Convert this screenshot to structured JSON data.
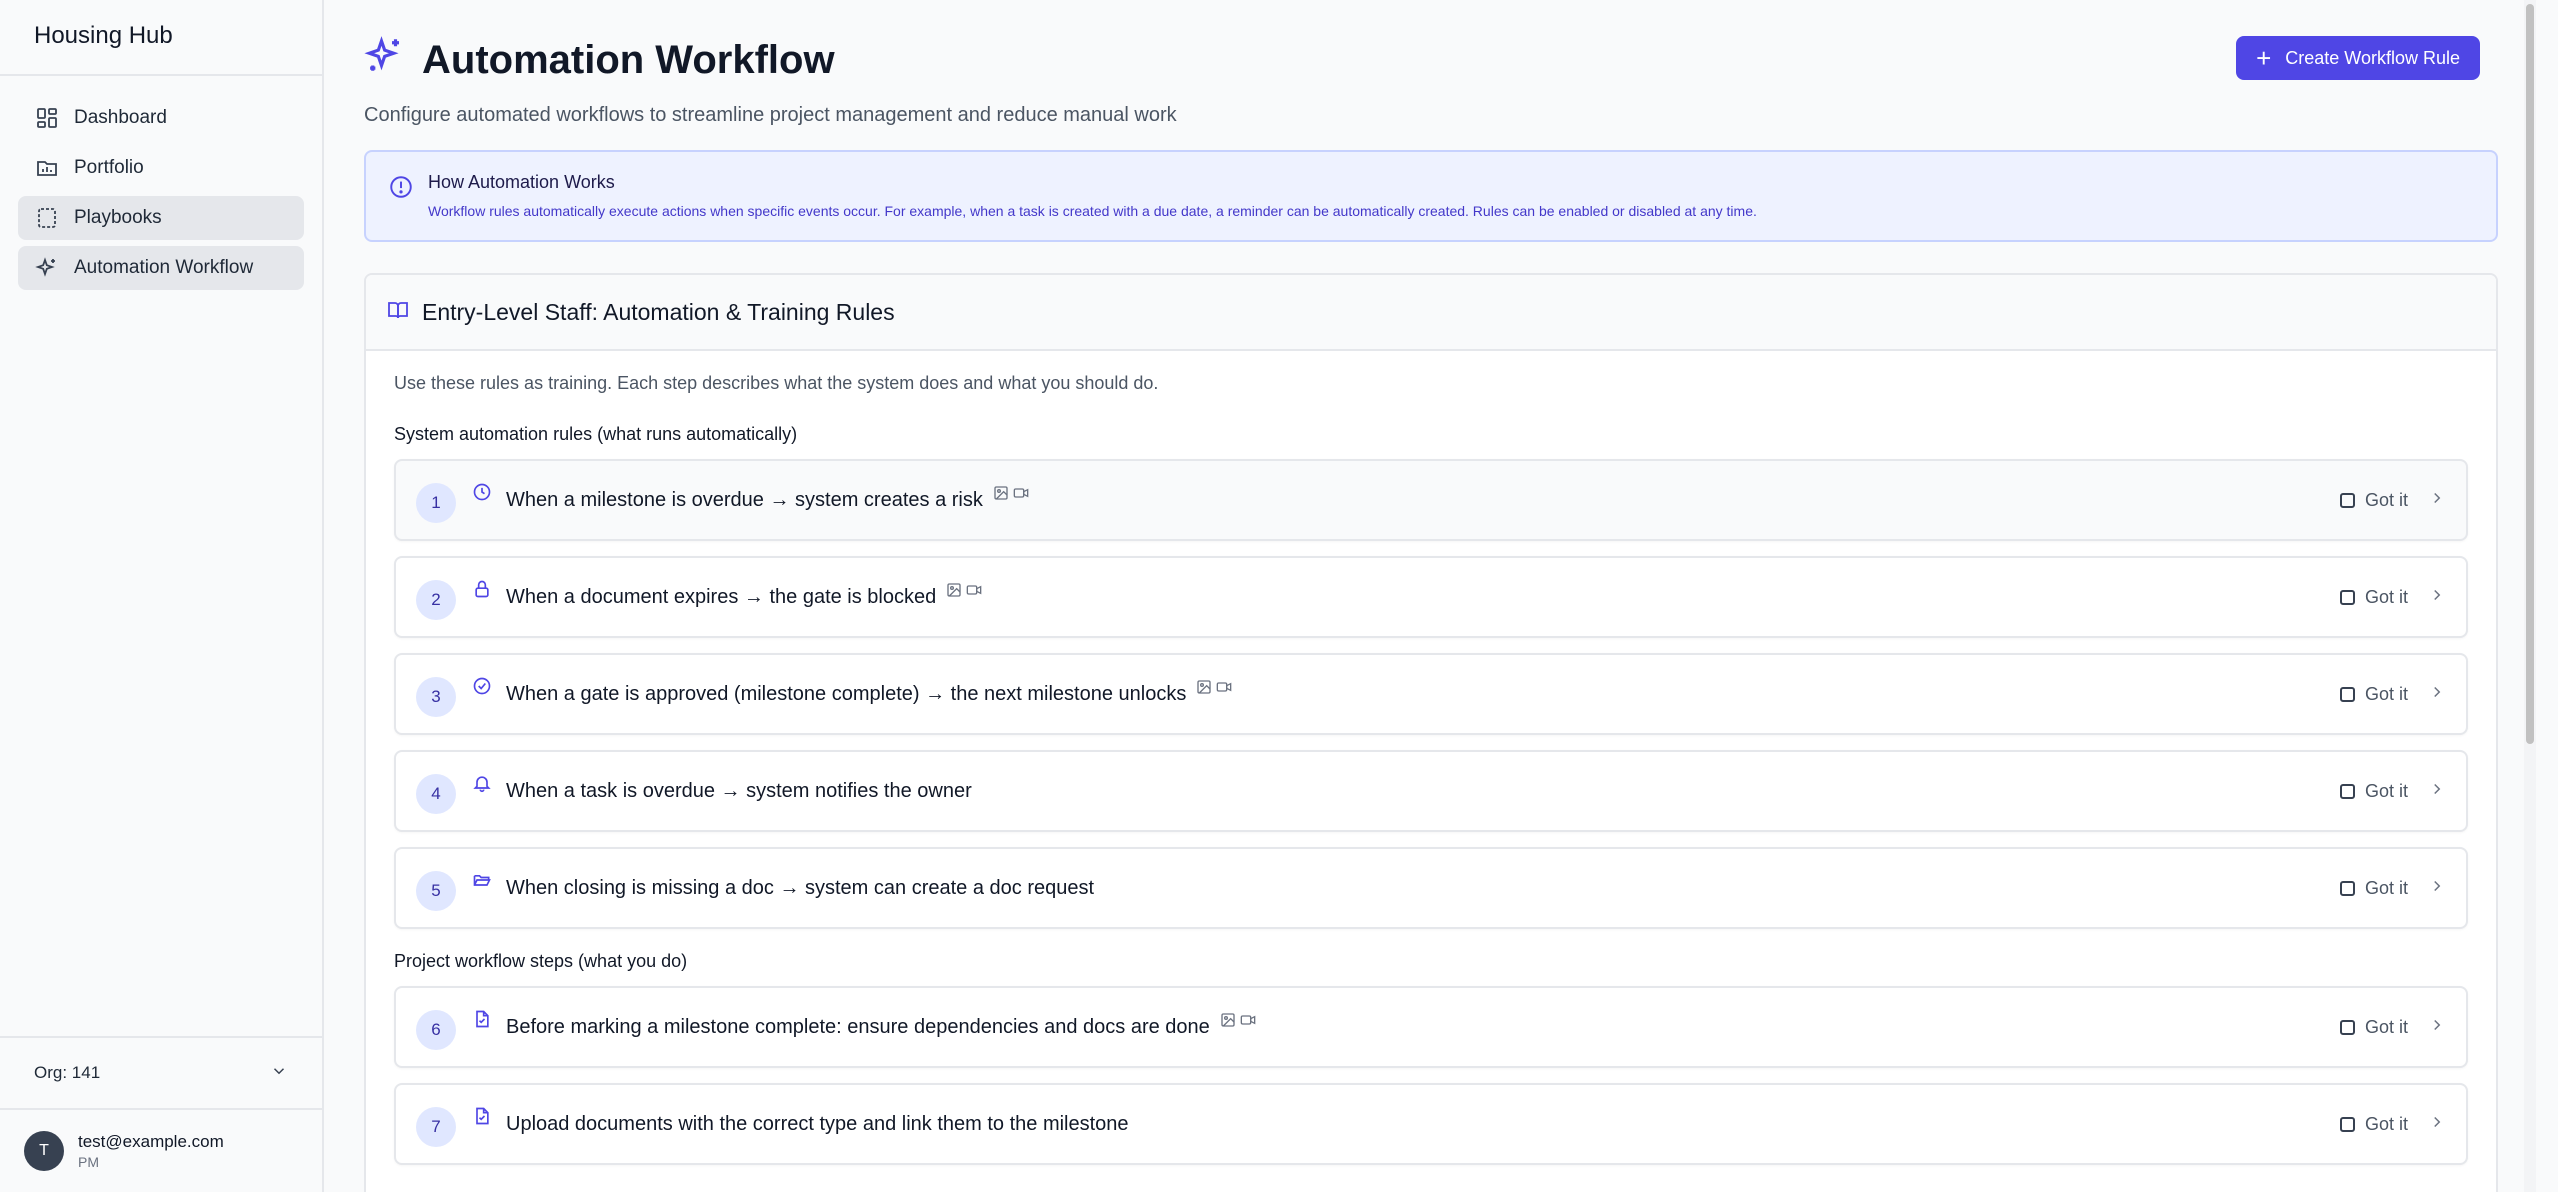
{
  "app": {
    "title": "Housing Hub"
  },
  "sidebar": {
    "items": [
      {
        "label": "Dashboard",
        "icon": "dashboard-icon"
      },
      {
        "label": "Portfolio",
        "icon": "portfolio-icon"
      },
      {
        "label": "Playbooks",
        "icon": "playbooks-icon"
      },
      {
        "label": "Automation Workflow",
        "icon": "sparkles-icon"
      }
    ],
    "org": "Org: 141",
    "user": {
      "initial": "T",
      "email": "test@example.com",
      "role": "PM"
    }
  },
  "header": {
    "title": "Automation Workflow",
    "subtitle": "Configure automated workflows to streamline project management and reduce manual work",
    "create_button": "Create Workflow Rule"
  },
  "info": {
    "title": "How Automation Works",
    "text": "Workflow rules automatically execute actions when specific events occur. For example, when a task is created with a due date, a reminder can be automatically created. Rules can be enabled or disabled at any time."
  },
  "training": {
    "title": "Entry-Level Staff: Automation & Training Rules",
    "intro": "Use these rules as training. Each step describes what the system does and what you should do.",
    "system_label": "System automation rules (what runs automatically)",
    "project_label": "Project workflow steps (what you do)",
    "got_it_label": "Got it",
    "system_rules": [
      {
        "num": "1",
        "text": "When a milestone is overdue → system creates a risk",
        "icon": "clock-icon",
        "media": true
      },
      {
        "num": "2",
        "text": "When a document expires → the gate is blocked",
        "icon": "lock-icon",
        "media": true
      },
      {
        "num": "3",
        "text": "When a gate is approved (milestone complete) → the next milestone unlocks",
        "icon": "check-circle-icon",
        "media": true
      },
      {
        "num": "4",
        "text": "When a task is overdue → system notifies the owner",
        "icon": "bell-icon",
        "media": false
      },
      {
        "num": "5",
        "text": "When closing is missing a doc → system can create a doc request",
        "icon": "folder-open-icon",
        "media": false
      }
    ],
    "project_steps": [
      {
        "num": "6",
        "text": "Before marking a milestone complete: ensure dependencies and docs are done",
        "icon": "file-check-icon",
        "media": true
      },
      {
        "num": "7",
        "text": "Upload documents with the correct type and link them to the milestone",
        "icon": "file-check-icon",
        "media": false
      }
    ]
  },
  "colors": {
    "accent": "#4f46e5",
    "info_bg": "#eef2ff",
    "badge_bg": "#e0e7ff"
  }
}
